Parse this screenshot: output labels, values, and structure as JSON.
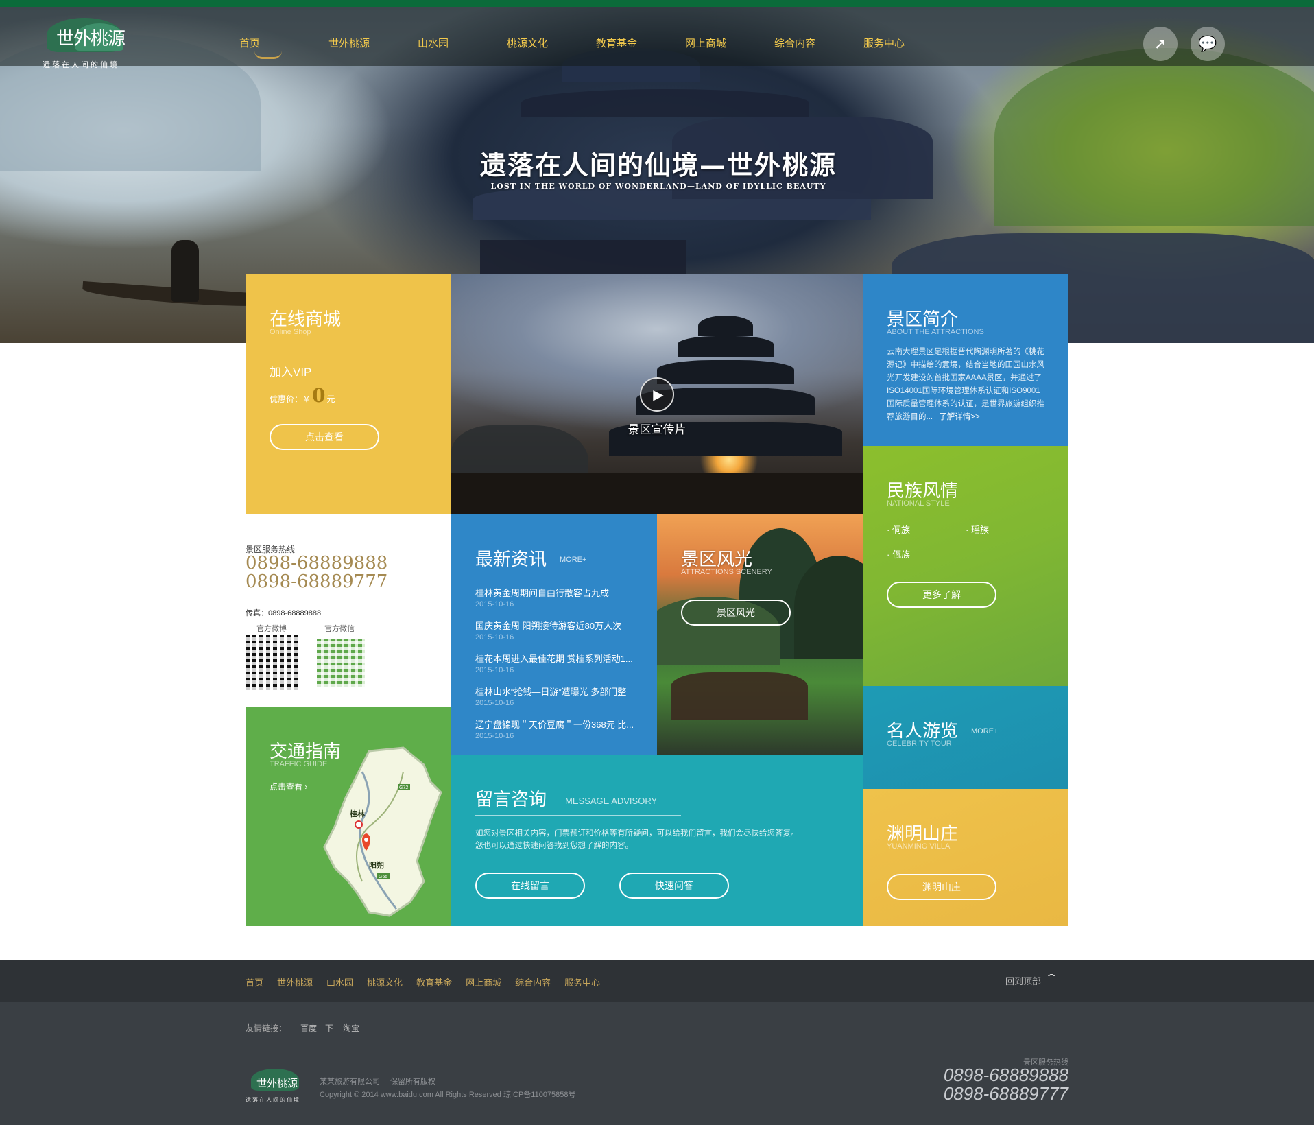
{
  "header": {
    "logo_text": "世外桃源",
    "logo_sub": "遗落在人间的仙境",
    "nav": [
      "首页",
      "世外桃源",
      "山水园",
      "桃源文化",
      "教育基金",
      "网上商城",
      "综合内容",
      "服务中心"
    ],
    "icons": [
      "compass-icon",
      "wechat-icon"
    ]
  },
  "hero": {
    "title": "遗落在人间的仙境—世外桃源",
    "subtitle": "LOST IN THE WORLD OF WONDERLAND—LAND OF IDYLLIC BEAUTY"
  },
  "shop": {
    "title": "在线商城",
    "en": "Online Shop",
    "vip": "加入VIP",
    "price_label": "优惠价：￥",
    "price": "0",
    "price_unit": "元",
    "button": "点击查看"
  },
  "video": {
    "caption": "景区宣传片"
  },
  "intro": {
    "title": "景区简介",
    "en": "ABOUT THE ATTRACTIONS",
    "text": "云南大理景区是根据晋代陶渊明所著的《桃花源记》中描绘的意境，结合当地的田园山水风光开发建设的首批国家AAAA景区，并通过了ISO14001国际环境管理体系认证和ISO9001国际质量管理体系的认证，是世界旅游组织推荐旅游目的...",
    "more": "了解详情>>"
  },
  "ethnic": {
    "title": "民族风情",
    "en": "NATIONAL STYLE",
    "items": [
      "侗族",
      "瑶族",
      "佤族"
    ],
    "button": "更多了解"
  },
  "celebrity": {
    "title": "名人游览",
    "en": "CELEBRITY TOUR",
    "more": "MORE+"
  },
  "villa": {
    "title": "渊明山庄",
    "en": "YUANMING VILLA",
    "button": "渊明山庄"
  },
  "contact": {
    "hotline_label": "景区服务热线",
    "phones": [
      "0898-68889888",
      "0898-68889777"
    ],
    "fax": "传真：0898-68889888",
    "weibo_label": "官方微博",
    "wechat_label": "官方微信"
  },
  "news": {
    "title": "最新资讯",
    "more": "MORE+",
    "items": [
      {
        "title": "桂林黄金周期间自由行散客占九成",
        "date": "2015-10-16"
      },
      {
        "title": "国庆黄金周 阳朔接待游客近80万人次",
        "date": "2015-10-16"
      },
      {
        "title": "桂花本周进入最佳花期 赏桂系列活动1...",
        "date": "2015-10-16"
      },
      {
        "title": "桂林山水“抢钱—日游”遭曝光 多部门整",
        "date": "2015-10-16"
      },
      {
        "title": "辽宁盘锦现＂天价豆腐＂一份368元 比...",
        "date": "2015-10-16"
      }
    ]
  },
  "scenery": {
    "title": "景区风光",
    "en": "ATTRACTIONS SCENERY",
    "button": "景区风光"
  },
  "traffic": {
    "title": "交通指南",
    "en": "TRAFFIC GUIDE",
    "link": "点击查看",
    "map_labels": {
      "guilin": "桂林",
      "yangshuo": "阳朔",
      "g72": "G72",
      "g65": "G65"
    }
  },
  "message": {
    "title": "留言咨询",
    "en": "MESSAGE ADVISORY",
    "text1": "如您对景区相关内容，门票预订和价格等有所疑问，可以给我们留言，我们会尽快给您答复。",
    "text2": "您也可以通过快速问答找到您想了解的内容。",
    "btn1": "在线留言",
    "btn2": "快速问答"
  },
  "footer": {
    "nav": [
      "首页",
      "世外桃源",
      "山水园",
      "桃源文化",
      "教育基金",
      "网上商城",
      "综合内容",
      "服务中心"
    ],
    "back_top": "回到顶部",
    "links_label": "友情链接：",
    "links": [
      "百度一下",
      "淘宝"
    ],
    "company": "某某旅游有限公司",
    "rights": "保留所有版权",
    "copyright": "Copyright © 2014 www.baidu.com All Rights Reserved 琼ICP备110075858号",
    "hotline_label": "景区服务热线",
    "phones": [
      "0898-68889888",
      "0898-68889777"
    ]
  },
  "colors": {
    "shop": "#efc34a",
    "intro": "#2e86c8",
    "ethnic": "#80b733",
    "celebrity": "#1d8fae",
    "villa": "#e9b843",
    "news": "#2f87c8",
    "traffic": "#5fae4a",
    "message": "#1fa8b3",
    "nav_text": "#f2c94c",
    "footer": "#3a3f44"
  }
}
